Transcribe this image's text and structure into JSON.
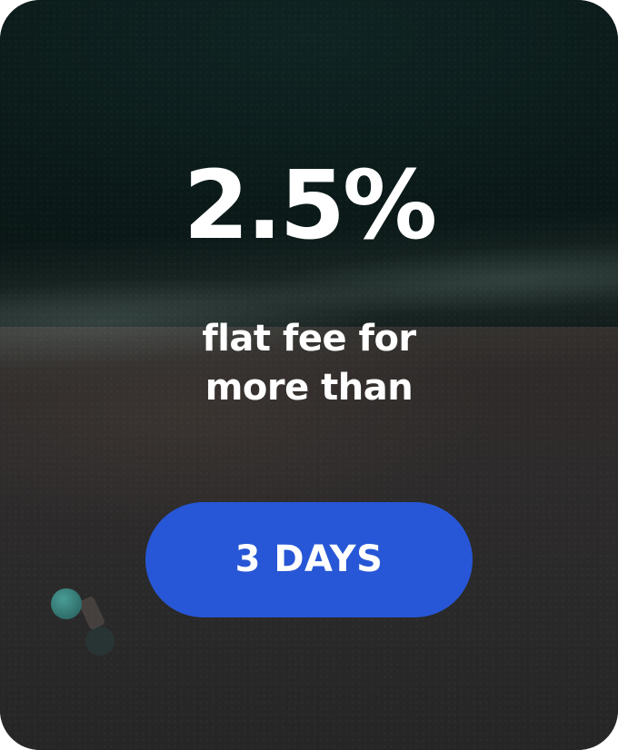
{
  "promo": {
    "rate": "2.5%",
    "description_line1": "flat fee for",
    "description_line2": "more than",
    "cta_label": "3 DAYS"
  },
  "colors": {
    "button": "#2757d6",
    "text": "#ffffff",
    "sea": "#0b1a19",
    "sand": "#2d2b2b"
  }
}
